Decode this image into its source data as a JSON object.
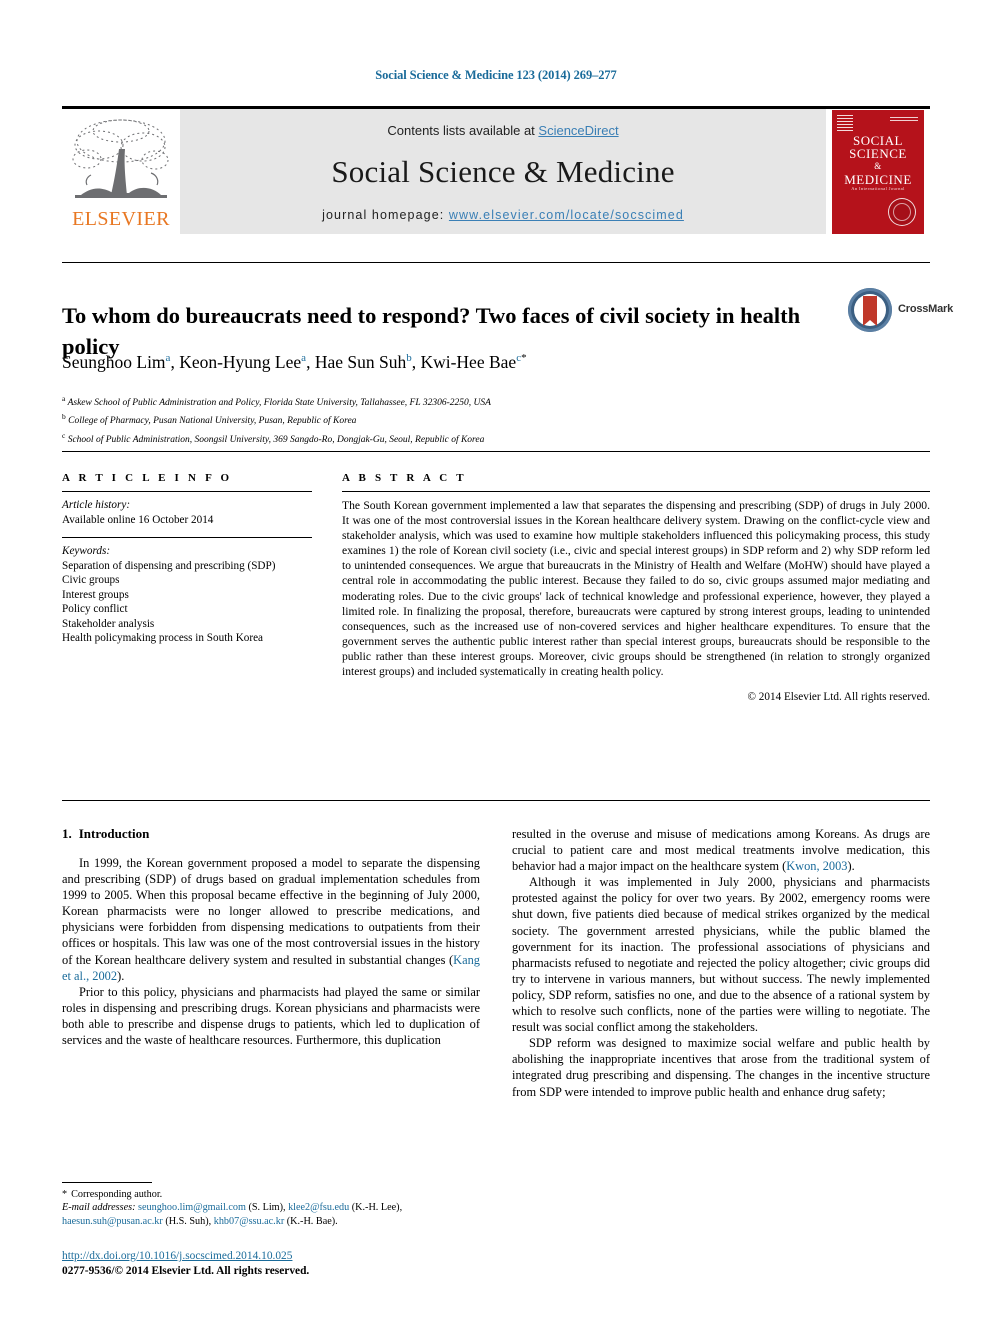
{
  "running_head": "Social Science & Medicine 123 (2014) 269–277",
  "masthead": {
    "publisher": "ELSEVIER",
    "contents_prefix": "Contents lists available at ",
    "contents_link": "ScienceDirect",
    "journal_title": "Social Science & Medicine",
    "homepage_prefix": "journal homepage: ",
    "homepage_url": "www.elsevier.com/locate/socscimed",
    "cover": {
      "line1": "SOCIAL",
      "line2": "SCIENCE",
      "amp": "&",
      "line3": "MEDICINE",
      "sub": "An International Journal"
    }
  },
  "article": {
    "title": "To whom do bureaucrats need to respond? Two faces of civil society in health policy",
    "crossmark_label": "CrossMark",
    "authors": [
      {
        "name": "Seunghoo Lim",
        "sup": "a",
        "star": false
      },
      {
        "name": "Keon-Hyung Lee",
        "sup": "a",
        "star": false
      },
      {
        "name": "Hae Sun Suh",
        "sup": "b",
        "star": false
      },
      {
        "name": "Kwi-Hee Bae",
        "sup": "c",
        "star": true
      }
    ],
    "affiliations": [
      {
        "marker": "a",
        "text": "Askew School of Public Administration and Policy, Florida State University, Tallahassee, FL 32306-2250, USA"
      },
      {
        "marker": "b",
        "text": "College of Pharmacy, Pusan National University, Pusan, Republic of Korea"
      },
      {
        "marker": "c",
        "text": "School of Public Administration, Soongsil University, 369 Sangdo-Ro, Dongjak-Gu, Seoul, Republic of Korea"
      }
    ]
  },
  "article_info": {
    "heading": "A R T I C L E  I N F O",
    "history_label": "Article history:",
    "history_value": "Available online 16 October 2014",
    "keywords_label": "Keywords:",
    "keywords": [
      "Separation of dispensing and prescribing (SDP)",
      "Civic groups",
      "Interest groups",
      "Policy conflict",
      "Stakeholder analysis",
      "Health policymaking process in South Korea"
    ]
  },
  "abstract": {
    "heading": "A B S T R A C T",
    "text": "The South Korean government implemented a law that separates the dispensing and prescribing (SDP) of drugs in July 2000. It was one of the most controversial issues in the Korean healthcare delivery system. Drawing on the conflict-cycle view and stakeholder analysis, which was used to examine how multiple stakeholders influenced this policymaking process, this study examines 1) the role of Korean civil society (i.e., civic and special interest groups) in SDP reform and 2) why SDP reform led to unintended consequences. We argue that bureaucrats in the Ministry of Health and Welfare (MoHW) should have played a central role in accommodating the public interest. Because they failed to do so, civic groups assumed major mediating and moderating roles. Due to the civic groups' lack of technical knowledge and professional experience, however, they played a limited role. In finalizing the proposal, therefore, bureaucrats were captured by strong interest groups, leading to unintended consequences, such as the increased use of non-covered services and higher healthcare expenditures. To ensure that the government serves the authentic public interest rather than special interest groups, bureaucrats should be responsible to the public rather than these interest groups. Moreover, civic groups should be strengthened (in relation to strongly organized interest groups) and included systematically in creating health policy.",
    "copyright": "© 2014 Elsevier Ltd. All rights reserved."
  },
  "body": {
    "section_number": "1.",
    "section_title": "Introduction",
    "left_paragraphs": [
      {
        "pre": "In 1999, the Korean government proposed a model to separate the dispensing and prescribing (SDP) of drugs based on gradual implementation schedules from 1999 to 2005. When this proposal became effective in the beginning of July 2000, Korean pharmacists were no longer allowed to prescribe medications, and physicians were forbidden from dispensing medications to outpatients from their offices or hospitals. This law was one of the most controversial issues in the history of the Korean healthcare delivery system and resulted in substantial changes (",
        "ref": "Kang et al., 2002",
        "post": ")."
      },
      {
        "pre": "Prior to this policy, physicians and pharmacists had played the same or similar roles in dispensing and prescribing drugs. Korean physicians and pharmacists were both able to prescribe and dispense drugs to patients, which led to duplication of services and the waste of healthcare resources. Furthermore, this duplication",
        "ref": "",
        "post": ""
      }
    ],
    "right_paragraphs": [
      {
        "pre": "resulted in the overuse and misuse of medications among Koreans. As drugs are crucial to patient care and most medical treatments involve medication, this behavior had a major impact on the healthcare system (",
        "ref": "Kwon, 2003",
        "post": ")."
      },
      {
        "pre": "Although it was implemented in July 2000, physicians and pharmacists protested against the policy for over two years. By 2002, emergency rooms were shut down, five patients died because of medical strikes organized by the medical society. The government arrested physicians, while the public blamed the government for its inaction. The professional associations of physicians and pharmacists refused to negotiate and rejected the policy altogether; civic groups did try to intervene in various manners, but without success. The newly implemented policy, SDP reform, satisfies no one, and due to the absence of a rational system by which to resolve such conflicts, none of the parties were willing to negotiate. The result was social conflict among the stakeholders.",
        "ref": "",
        "post": ""
      },
      {
        "pre": "SDP reform was designed to maximize social welfare and public health by abolishing the inappropriate incentives that arose from the traditional system of integrated drug prescribing and dispensing. The changes in the incentive structure from SDP were intended to improve public health and enhance drug safety;",
        "ref": "",
        "post": ""
      }
    ]
  },
  "footnotes": {
    "corresponding": "Corresponding author.",
    "email_label": "E-mail addresses:",
    "emails": [
      {
        "address": "seunghoo.lim@gmail.com",
        "owner": "(S. Lim),"
      },
      {
        "address": "klee2@fsu.edu",
        "owner": "(K.-H. Lee),"
      },
      {
        "address": "haesun.suh@pusan.ac.kr",
        "owner": "(H.S. Suh),"
      },
      {
        "address": "khb07@ssu.ac.kr",
        "owner": "(K.-H. Bae)."
      }
    ]
  },
  "doi": {
    "url": "http://dx.doi.org/10.1016/j.socscimed.2014.10.025",
    "issn_line": "0277-9536/© 2014 Elsevier Ltd. All rights reserved."
  },
  "colors": {
    "link": "#1a6b9a",
    "banner_bg": "#e6e6e6",
    "elsevier_orange": "#E87722",
    "cover_red": "#b5121b"
  }
}
